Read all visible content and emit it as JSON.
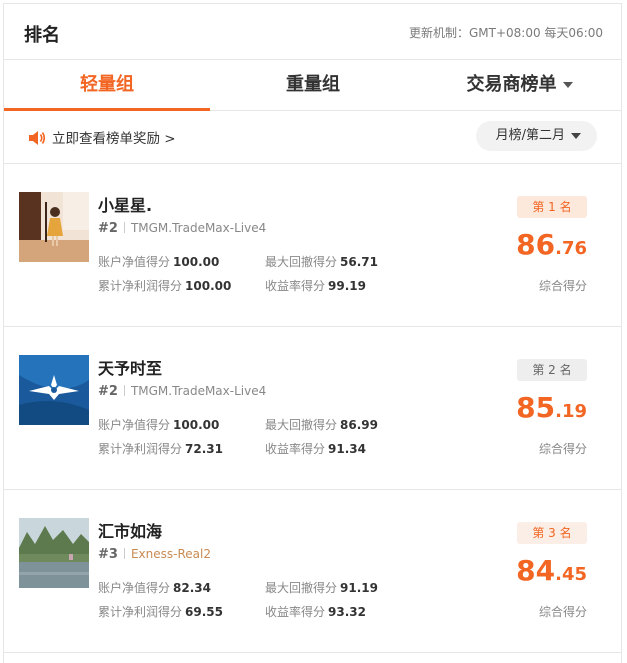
{
  "header": {
    "title": "排名",
    "update": "更新机制：GMT+08:00 每天06:00"
  },
  "tabs": [
    {
      "label": "轻量组"
    },
    {
      "label": "重量组"
    },
    {
      "label": "交易商榜单"
    }
  ],
  "promo": {
    "label": "立即查看榜单奖励 >"
  },
  "period": {
    "label": "月榜/第二月"
  },
  "stat_labels": {
    "equity": "账户净值得分",
    "drawdown": "最大回撤得分",
    "profit": "累计净利润得分",
    "return": "收益率得分"
  },
  "score_label": "综合得分",
  "entries": [
    {
      "name": "小星星.",
      "rank": "#2",
      "server": "TMGM.TradeMax-Live4",
      "badge": "第 1 名",
      "equity": "100.00",
      "drawdown": "56.71",
      "profit": "100.00",
      "return": "99.19",
      "score_int": "86",
      "score_dec": ".76"
    },
    {
      "name": "天予时至",
      "rank": "#2",
      "server": "TMGM.TradeMax-Live4",
      "badge": "第 2 名",
      "equity": "100.00",
      "drawdown": "86.99",
      "profit": "72.31",
      "return": "91.34",
      "score_int": "85",
      "score_dec": ".19"
    },
    {
      "name": "汇市如海",
      "rank": "#3",
      "server": "Exness-Real2",
      "badge": "第 3 名",
      "equity": "82.34",
      "drawdown": "91.19",
      "profit": "69.55",
      "return": "93.32",
      "score_int": "84",
      "score_dec": ".45"
    }
  ],
  "colors": {
    "accent": "#f26522",
    "border": "#e6e6e6"
  }
}
